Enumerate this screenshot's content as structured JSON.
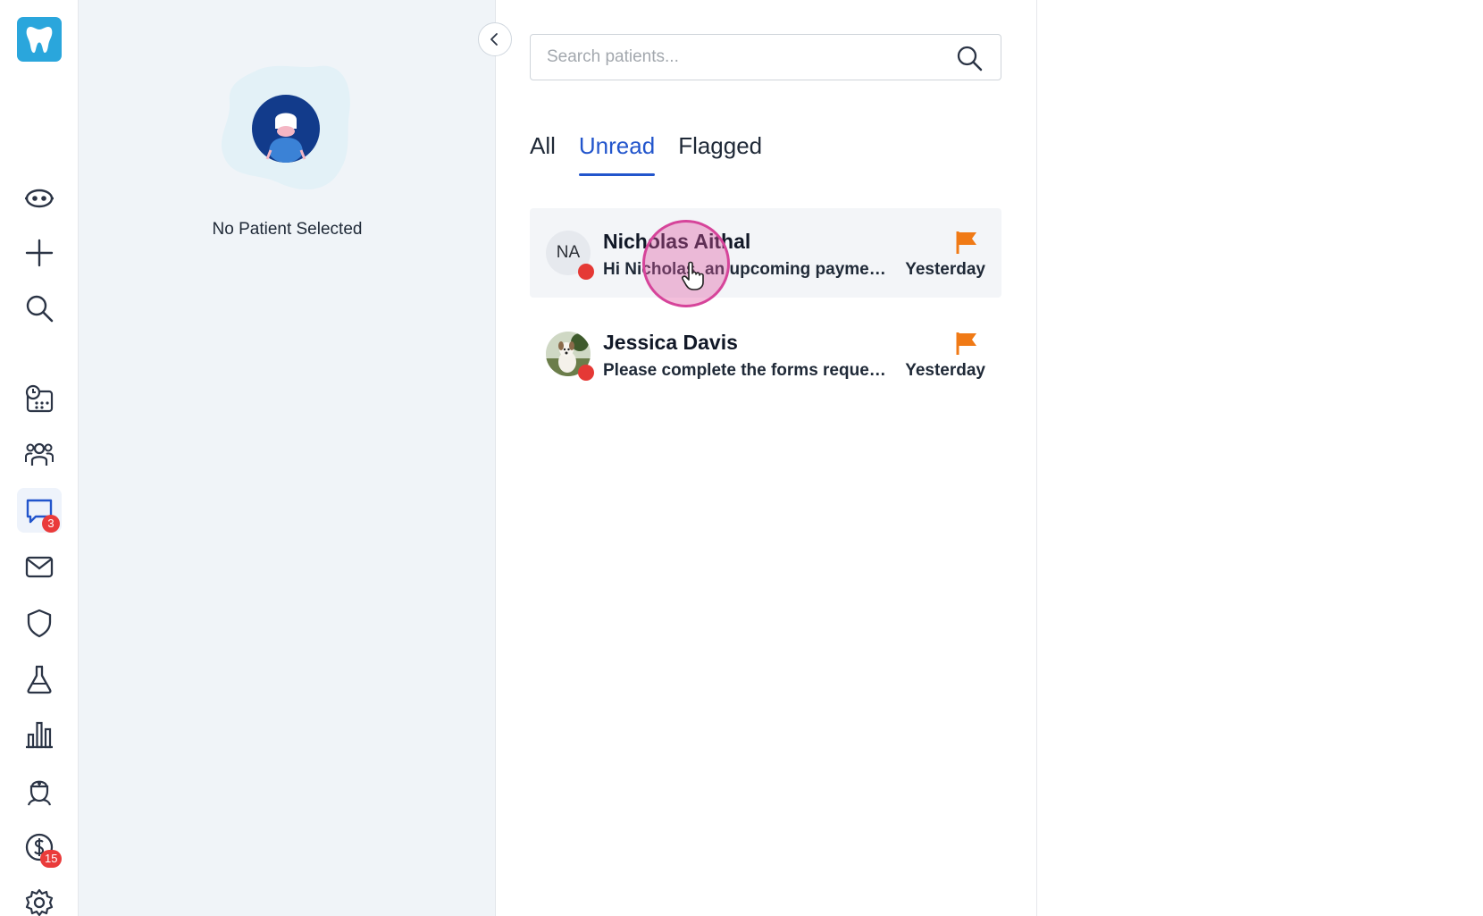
{
  "patient_panel": {
    "empty_text": "No Patient Selected"
  },
  "search": {
    "placeholder": "Search patients...",
    "value": ""
  },
  "tabs": [
    {
      "label": "All",
      "active": false
    },
    {
      "label": "Unread",
      "active": true
    },
    {
      "label": "Flagged",
      "active": false
    }
  ],
  "conversations": [
    {
      "initials": "NA",
      "name": "Nicholas Aithal",
      "preview": "Hi Nicholas, an upcoming payment reminder",
      "time": "Yesterday",
      "flagged": true,
      "unread": true
    },
    {
      "initials": "",
      "name": "Jessica Davis",
      "preview": "Please complete the forms requested",
      "time": "Yesterday",
      "flagged": true,
      "unread": true
    }
  ],
  "rail": {
    "messages_badge": "3",
    "billing_badge": "15"
  },
  "colors": {
    "accent": "#2255cc",
    "logo": "#2aa6dc",
    "flag": "#f07a16",
    "unread_dot": "#e53935",
    "badge": "#ea3b3b"
  },
  "icons": [
    "tooth-logo-icon",
    "robot-icon",
    "plus-icon",
    "search-icon",
    "schedule-icon",
    "patients-icon",
    "chat-icon",
    "mail-icon",
    "shield-icon",
    "lab-flask-icon",
    "analytics-icon",
    "doctor-icon",
    "billing-icon",
    "settings-icon",
    "chevron-left-icon",
    "flag-icon"
  ]
}
